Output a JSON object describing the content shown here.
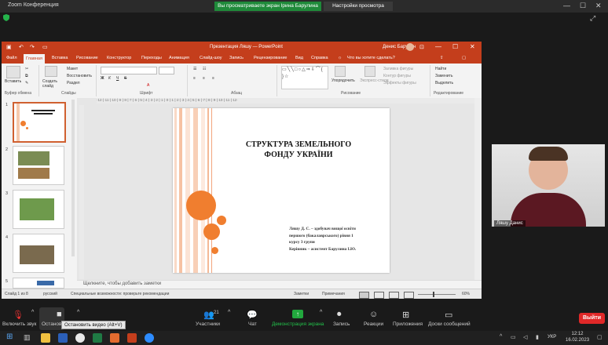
{
  "zoom": {
    "window_title": "Zoom Конференция",
    "share_banner": "Вы просматриваете экран Ірина Барулина",
    "view_options": "Настройки просмотра",
    "window_controls": [
      "—",
      "☐",
      "✕"
    ]
  },
  "ppt": {
    "title": "Презентация Ляшу — PowerPoint",
    "user": "Денис Барулин",
    "window_controls": [
      "—",
      "☐",
      "✕"
    ],
    "tabs": [
      "Файл",
      "Главная",
      "Вставка",
      "Рисование",
      "Конструктор",
      "Переходы",
      "Анимация",
      "Слайд-шоу",
      "Запись",
      "Рецензирование",
      "Вид",
      "Справка",
      "Что вы хотите сделать?"
    ],
    "ribbon": {
      "paste": "Вставить",
      "new_slide": "Создать слайд",
      "layout": "Макет",
      "reset": "Восстановить",
      "section": "Раздел",
      "arrange": "Упорядочить",
      "quick_styles": "Экспресс-стили",
      "fill": "Заливка фигуры",
      "outline": "Контур фигуры",
      "effects": "Эффекты фигуры",
      "find": "Найти",
      "replace": "Заменить",
      "select": "Выделить",
      "groups": [
        "Буфер обмена",
        "Слайды",
        "Шрифт",
        "Абзац",
        "Рисование",
        "Редактирование"
      ]
    },
    "ruler_marks": "·12·|·11·|·10·|·9·|·8·|·7·|·6·|·5·|·4·|·3·|·2·|·1·|·0·|·1·|·2·|·3·|·4·|·5·|·6·|·7·|·8·|·9·|·10·|·11·|·12·",
    "thumbnails": [
      "1",
      "2",
      "3",
      "4",
      "5"
    ],
    "slide": {
      "title_line1": "СТРУКТУРА ЗЕМЕЛЬНОГО",
      "title_line2": "ФОНДУ УКРАЇНИ",
      "body": [
        "Ляшу Д. С. – здобувач вищої освіти",
        "першого (бакалаврського) рівня 1",
        "курсу 3 групи",
        "Керівник – асистент Барулина І.Ю."
      ]
    },
    "notes_placeholder": "Щелкните, чтобы добавить заметки",
    "status": {
      "slide": "Слайд 1 из 8",
      "language": "русский",
      "accessibility": "Специальные возможности: проверьте рекомендации",
      "notes": "Заметки",
      "comments": "Примечания",
      "zoom": "60%"
    }
  },
  "video": {
    "participant": "Ляшу Данис"
  },
  "toolbar": {
    "unmute": "Включить звук",
    "stop_video": "Останов",
    "tooltip": "Остановить видео (Alt+V)",
    "participants": "Участники",
    "participants_count": "21",
    "chat": "Чат",
    "share": "Демонстрация экрана",
    "record": "Запись",
    "reactions": "Реакции",
    "apps": "Приложения",
    "whiteboard": "Доски сообщений",
    "leave": "Выйти"
  },
  "taskbar": {
    "lang": "УКР",
    "time": "12:12",
    "date": "16.02.2023"
  }
}
